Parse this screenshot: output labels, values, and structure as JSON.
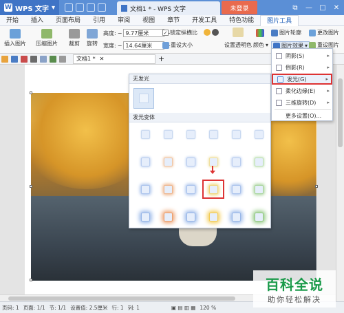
{
  "titlebar": {
    "app_name": "WPS 文字",
    "doc_title": "文档1 * - WPS 文字",
    "login": "未登录",
    "controls": [
      "⧉",
      "—",
      "□",
      "✕"
    ]
  },
  "menubar": {
    "tabs": [
      "开始",
      "插入",
      "页面布局",
      "引用",
      "审阅",
      "视图",
      "章节",
      "开发工具",
      "特色功能",
      "图片工具"
    ],
    "active": "图片工具"
  },
  "ribbon": {
    "insert_pic": "插入图片",
    "compress_pic": "压缩图片",
    "crop": "裁剪",
    "rotate": "旋转",
    "height_label": "高度:",
    "height_value": "9.77厘米",
    "width_label": "宽度:",
    "width_value": "14.64厘米",
    "lock_ratio": "锁定纵横比",
    "reset_size": "重设大小",
    "set_transparent": "设置透明色",
    "color": "颜色",
    "picture_outline": "图片轮廓",
    "change_picture": "更改图片",
    "picture_effect": "图片效果",
    "reset_picture": "重设图片"
  },
  "toolbar2": {
    "file_tab": "文档1 *",
    "add": "+"
  },
  "glow_panel": {
    "no_glow_header": "无发光",
    "variants_header": "发光变体",
    "rows": [
      [
        "#c8d8f0",
        "#c8d8f0",
        "#c8d8f0",
        "#c8d8f0",
        "#c8d8f0",
        "#c8d8f0"
      ],
      [
        "#b9cdef",
        "#f0c7a6",
        "#b9cdef",
        "#f0e0a0",
        "#b9cdef",
        "#bfe0b4"
      ],
      [
        "#a9c2ec",
        "#eeb48a",
        "#a9c2ec",
        "#f1d678",
        "#a9c2ec",
        "#a8d49b"
      ],
      [
        "#97b6e8",
        "#ec9f6c",
        "#97b6e8",
        "#f3cc55",
        "#97b6e8",
        "#92c982"
      ]
    ]
  },
  "effect_menu": {
    "items": [
      {
        "label": "阴影(S)",
        "icon": "shadow-icon"
      },
      {
        "label": "倒影(R)",
        "icon": "reflection-icon"
      },
      {
        "label": "发光(G)",
        "icon": "glow-icon"
      },
      {
        "label": "柔化边缘(E)",
        "icon": "soft-edge-icon"
      },
      {
        "label": "三维旋转(D)",
        "icon": "3d-rotate-icon"
      },
      {
        "label": "更多设置(O)...",
        "icon": "more-settings-icon"
      }
    ],
    "highlighted": "发光(G)"
  },
  "statusbar": {
    "page": "页码: 1",
    "pages": "页面: 1/1",
    "section": "节: 1/1",
    "position": "设置值: 2.5厘米",
    "row": "行: 1",
    "col": "列: 1",
    "zoom": "120 %"
  },
  "watermark": {
    "line1": "百科全说",
    "line2": "助你轻松解决"
  }
}
